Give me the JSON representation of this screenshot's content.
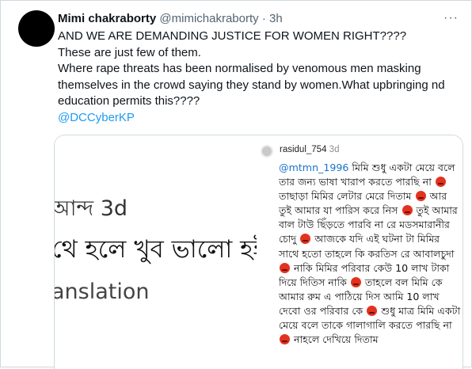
{
  "tweet": {
    "author_name": "Mimi chakraborty",
    "handle": "@mimichakraborty",
    "separator": "·",
    "time": "3h",
    "more_icon": "···",
    "lines": [
      "AND WE ARE DEMANDING JUSTICE FOR WOMEN RIGHT????",
      "These are just few of them.",
      "Where rape threats has been normalised by venomous men masking themselves in the crowd saying they stand by women.What upbringing nd education permits this????"
    ],
    "mention": "@DCCyberKP"
  },
  "media_left": {
    "line1": "আন্দ 3d",
    "line2": "থে হলে খুব ভালো হইত",
    "line3": "anslation"
  },
  "media_right": {
    "username": "rasidul_754",
    "time": "3d",
    "mention": "@mtmn_1996",
    "segments": [
      "মিমি শুধু একটা মেয়ে বলে তার জন্য ভাষা খারাপ করতে পারছি না",
      "তাছাড়া মিমির লেটার মেরে দিতাম",
      "আর তুই আমার যা পারিস করে নিস",
      "তুই আমার বাল টাউ ছিঁড়তে পারবি না রে মডসমারানীর চোদু",
      "আজকে যদি এই ঘটনা টা মিমির সাথে হতো তাহলে কি করতিস রে আবালচুদা",
      "নাকি মিমির পরিবার কেউ 10 লাখ টাকা দিয়ে দিতিস নাকি",
      "তাহলে বল মিমি কে আমার রুম এ পাঠিয়ে দিস আমি 10 লাখ দেবো ওর পরিবার কে",
      "শুধু মাত্র মিমি একটা মেয়ে বলে তাকে গালাগালি করতে পারছি না",
      "নাহলে দেখিয়ে দিতাম"
    ],
    "emoji_name": "angry-face-emoji"
  },
  "colors": {
    "accent": "#1d9bf0",
    "muted": "#536471",
    "emoji": "#e2331e"
  }
}
